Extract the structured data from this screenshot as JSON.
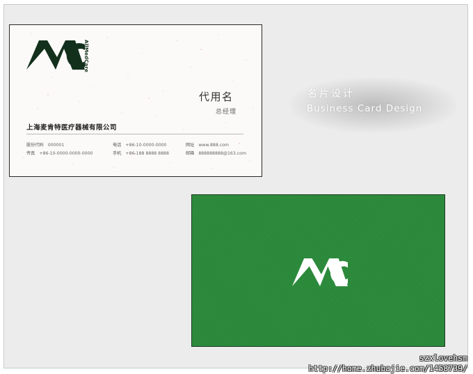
{
  "front_card": {
    "logo_vertical_text": "AllMedCare",
    "person_name": "代用名",
    "person_title": "总经理",
    "company_name": "上海麦肯特医疗器械有限公司",
    "info": {
      "stock_code_label": "股份代码",
      "stock_code_value": "000001",
      "fax_label": "传真",
      "fax_value": "+86-10-0000-0000-0000",
      "phone_label": "电话",
      "phone_value": "+86-10-0000-0000",
      "mobile_label": "手机",
      "mobile_value": "+86-188 8888 8888",
      "website_label": "网址",
      "website_value": "www.888.com",
      "email_label": "邮箱",
      "email_value": "888888888@163.com"
    }
  },
  "slogan": {
    "chinese": "名片设计",
    "english": "Business Card Design"
  },
  "back_card": {
    "background_color": "#2a8a3a"
  },
  "watermark": {
    "line1": "szxlovehsm",
    "line2": "http://home.zhubajie.com/1458739/"
  },
  "colors": {
    "logo_dark_green": "#13301c",
    "back_green": "#2a8a3a"
  }
}
